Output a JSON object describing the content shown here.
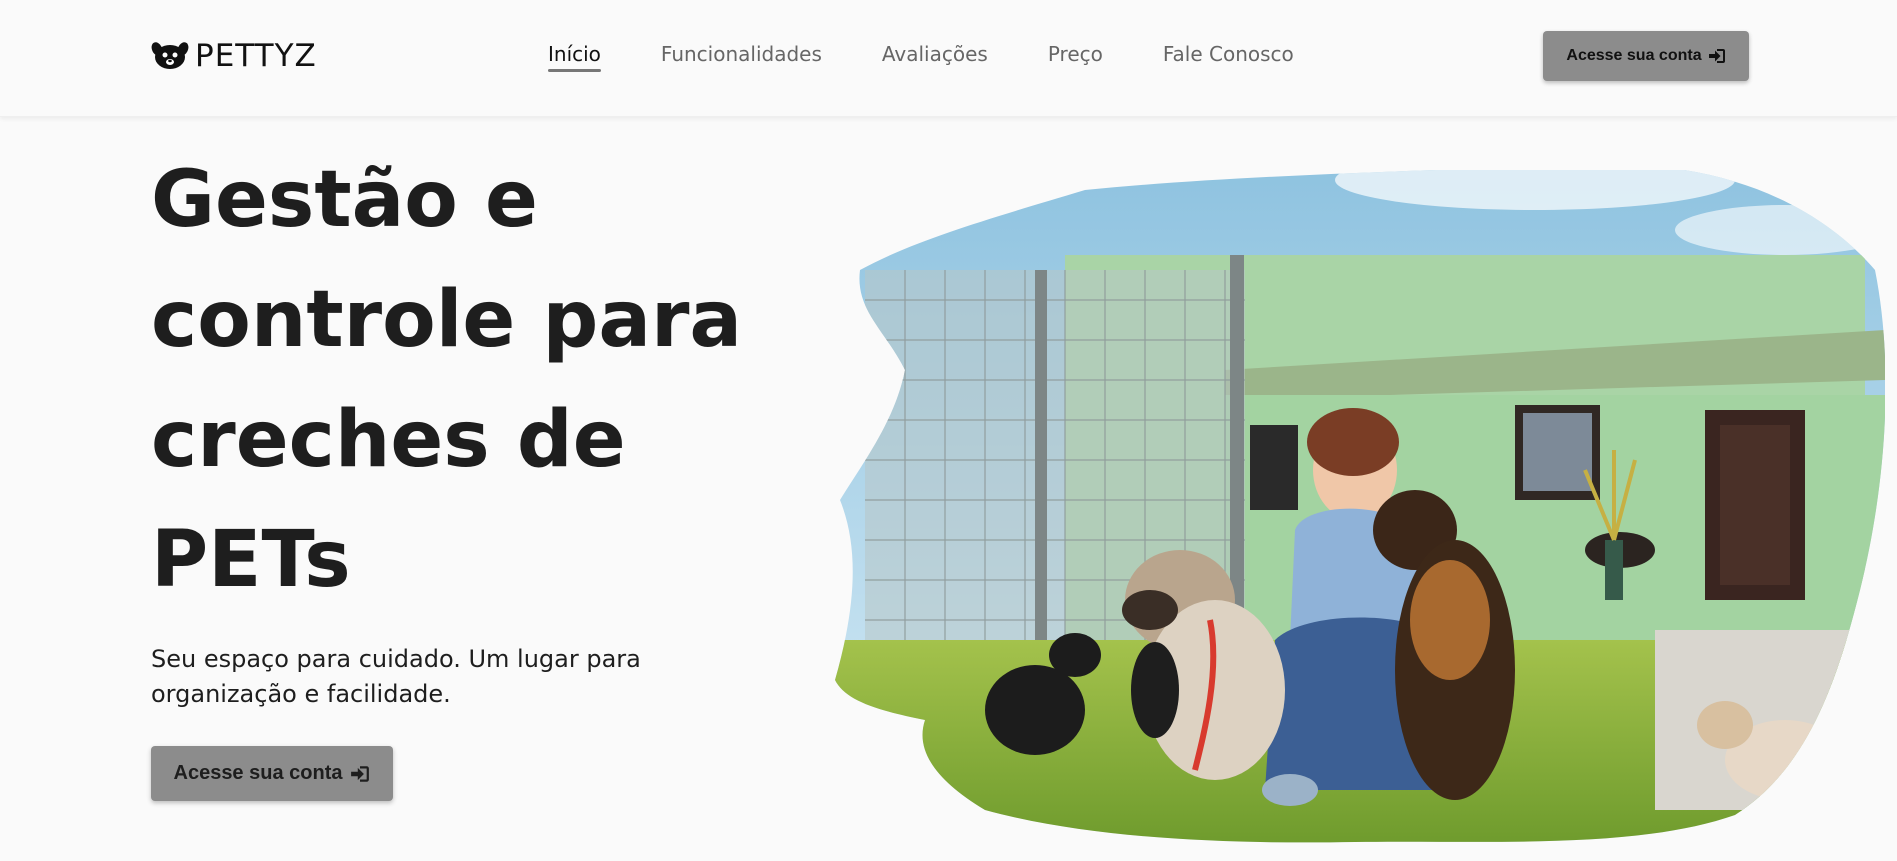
{
  "brand": {
    "name": "PETTYZ"
  },
  "nav": {
    "items": [
      {
        "label": "Início",
        "active": true
      },
      {
        "label": "Funcionalidades",
        "active": false
      },
      {
        "label": "Avaliações",
        "active": false
      },
      {
        "label": "Preço",
        "active": false
      },
      {
        "label": "Fale Conosco",
        "active": false
      }
    ]
  },
  "header": {
    "cta_label": "Acesse sua conta"
  },
  "hero": {
    "title_lines": [
      "Gestão e",
      "controle para",
      "creches de",
      "PETs"
    ],
    "subtitle_line1": "Seu espaço para cuidado. Um lugar para",
    "subtitle_line2": "organização e facilidade.",
    "cta_label": "Acesse sua conta"
  },
  "colors": {
    "background": "#fafafa",
    "button": "#8c8c8c",
    "text": "#1e1e1e",
    "nav_inactive": "#666666"
  },
  "icons": {
    "login": "sign-in-icon",
    "logo": "dog-face-icon"
  }
}
